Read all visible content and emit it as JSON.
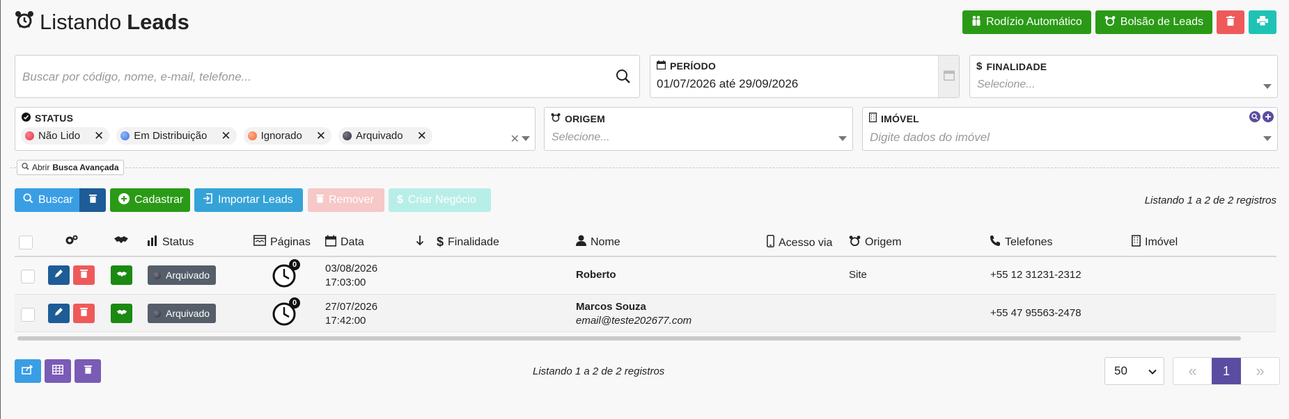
{
  "header": {
    "title_prefix": "Listando",
    "title_strong": "Leads",
    "btn_rodizio": "Rodízio Automático",
    "btn_bolsao": "Bolsão de Leads"
  },
  "filters": {
    "search_placeholder": "Buscar por código, nome, e-mail, telefone...",
    "periodo_label": "PERÍODO",
    "periodo_value": "01/07/2026 até 29/09/2026",
    "finalidade_label": "FINALIDADE",
    "finalidade_placeholder": "Selecione...",
    "status_label": "STATUS",
    "status_chips": [
      {
        "label": "Não Lido",
        "color": "#e0364a"
      },
      {
        "label": "Em Distribuição",
        "color": "#3f74d9"
      },
      {
        "label": "Ignorado",
        "color": "#f0683a"
      },
      {
        "label": "Arquivado",
        "color": "#2b2b3a"
      }
    ],
    "origem_label": "ORIGEM",
    "origem_placeholder": "Selecione...",
    "imovel_label": "IMÓVEL",
    "imovel_placeholder": "Digite dados do imóvel"
  },
  "advanced": {
    "prefix": "Abrir",
    "strong": "Busca Avançada"
  },
  "toolbar": {
    "buscar": "Buscar",
    "cadastrar": "Cadastrar",
    "importar": "Importar Leads",
    "remover": "Remover",
    "criar_negocio": "Criar Negócio"
  },
  "records_text": "Listando 1 a 2 de 2 registros",
  "table": {
    "columns": {
      "status": "Status",
      "paginas": "Páginas",
      "data": "Data",
      "finalidade": "Finalidade",
      "nome": "Nome",
      "acesso": "Acesso via",
      "origem": "Origem",
      "telefones": "Telefones",
      "imovel": "Imóvel"
    },
    "rows": [
      {
        "status": "Arquivado",
        "pages": "0",
        "date": "03/08/2026",
        "time": "17:03:00",
        "finalidade": "",
        "name": "Roberto",
        "email": "",
        "acesso": "",
        "origem": "Site",
        "telefone": "+55 12 31231-2312",
        "imovel": ""
      },
      {
        "status": "Arquivado",
        "pages": "0",
        "date": "27/07/2026",
        "time": "17:42:00",
        "finalidade": "",
        "name": "Marcos Souza",
        "email": "email@teste202677.com",
        "acesso": "",
        "origem": "",
        "telefone": "+55 47 95563-2478",
        "imovel": ""
      }
    ]
  },
  "pagination": {
    "per_page": "50",
    "current": "1",
    "prev": "«",
    "next": "»"
  },
  "colors": {
    "green": "#2a9a16",
    "red": "#ee5a5a",
    "teal": "#1fc3b5",
    "blue": "#3a9ee4",
    "darkblue": "#1d5c97",
    "purple": "#5a4da1"
  }
}
